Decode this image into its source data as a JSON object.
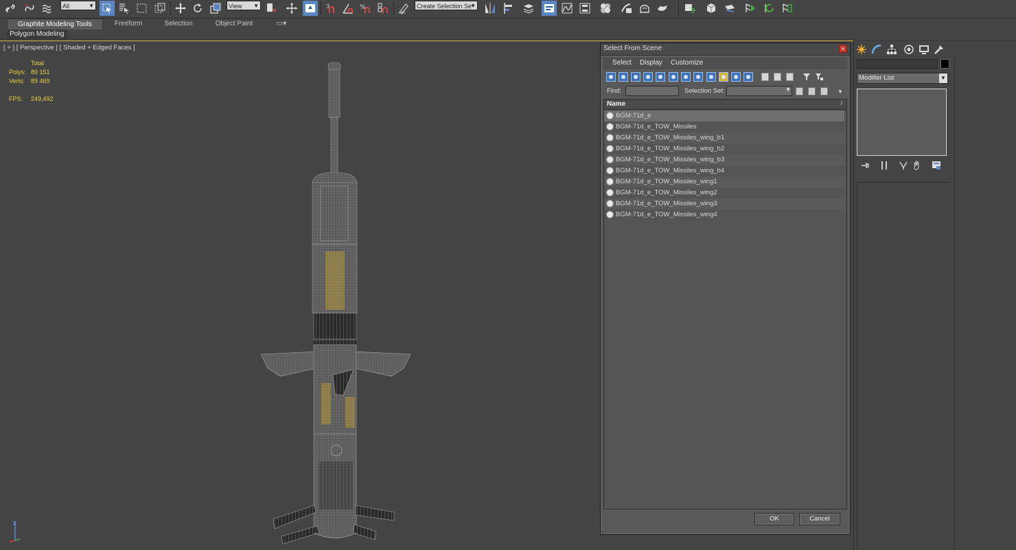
{
  "toolbar": {
    "filter_value": "All",
    "ref_coord_value": "View",
    "selection_set_placeholder": "Create Selection Se",
    "icons": [
      "link-icon",
      "unlink-icon",
      "bind-spacewarp-icon",
      "select-object-icon",
      "select-by-name-icon",
      "rect-region-icon",
      "window-crossing-icon",
      "move-icon",
      "rotate-icon",
      "scale-icon",
      "pivot-icon",
      "select-manipulate-icon",
      "keyboard-shortcut-icon",
      "snap-3-icon",
      "angle-snap-icon",
      "percent-snap-icon",
      "spinner-snap-icon",
      "edit-named-sel-icon",
      "mirror-icon",
      "align-icon",
      "layer-manager-icon",
      "scene-explorer-icon",
      "curve-editor-icon",
      "schematic-view-icon",
      "material-editor-icon",
      "render-setup-icon",
      "rendered-frame-icon",
      "render-icon",
      "civil-view-icon"
    ]
  },
  "ribbon": {
    "tabs": [
      "Graphite Modeling Tools",
      "Freeform",
      "Selection",
      "Object Paint"
    ],
    "active_tab": "Graphite Modeling Tools",
    "panel_label": "Polygon Modeling"
  },
  "viewport": {
    "label": "[ + ] [ Perspective ] [ Shaded + Edged Faces ]",
    "stats": {
      "total_label": "Total",
      "polys_label": "Polys:",
      "polys_value": "89 151",
      "verts_label": "Verts:",
      "verts_value": "89 469",
      "fps_label": "FPS:",
      "fps_value": "249,492"
    },
    "axis_label": "z"
  },
  "dialog": {
    "title": "Select From Scene",
    "close_glyph": "×",
    "menu": [
      "Select",
      "Display",
      "Customize"
    ],
    "find_label": "Find:",
    "find_value": "",
    "selection_set_label": "Selection Set:",
    "column_header": "Name",
    "sort_glyph": "/",
    "items": [
      "BGM-71d_e",
      "BGM-71d_e_TOW_Missiles",
      "BGM-71d_e_TOW_Missiles_wing_b1",
      "BGM-71d_e_TOW_Missiles_wing_b2",
      "BGM-71d_e_TOW_Missiles_wing_b3",
      "BGM-71d_e_TOW_Missiles_wing_b4",
      "BGM-71d_e_TOW_Missiles_wing1",
      "BGM-71d_e_TOW_Missiles_wing2",
      "BGM-71d_e_TOW_Missiles_wing3",
      "BGM-71d_e_TOW_Missiles_wing4"
    ],
    "ok_label": "OK",
    "cancel_label": "Cancel"
  },
  "command_panel": {
    "tabs": [
      "create-tab-icon",
      "modify-tab-icon",
      "hierarchy-tab-icon",
      "motion-tab-icon",
      "display-tab-icon",
      "utilities-tab-icon"
    ],
    "modifier_list_label": "Modifier List",
    "stack_buttons": [
      "pin-stack-icon",
      "show-end-result-icon",
      "make-unique-icon",
      "remove-modifier-icon",
      "configure-modifier-sets-icon"
    ]
  },
  "colors": {
    "background": "#444444",
    "selection_blue": "#5a86c4",
    "stats_yellow": "#e8d440",
    "viewport_border": "#e0c050",
    "missile_wire": "#8a8a8a",
    "missile_accent": "#b89a48"
  }
}
